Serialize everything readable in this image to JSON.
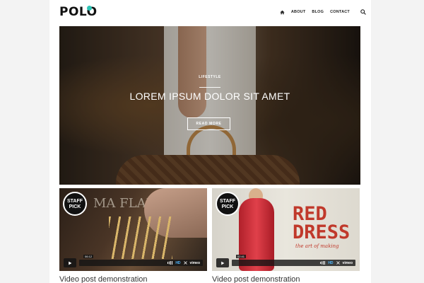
{
  "header": {
    "logo": "POLO",
    "nav": [
      {
        "id": "home",
        "icon": "home-icon"
      },
      {
        "id": "about",
        "label": "ABOUT"
      },
      {
        "id": "blog",
        "label": "BLOG"
      },
      {
        "id": "contact",
        "label": "CONTACT"
      }
    ],
    "search_icon": "search-icon",
    "accent": "#2ec4b6"
  },
  "hero": {
    "tag": "LIFESTYLE",
    "title": "LOREM IPSUM DOLOR SIT AMET",
    "button": "READ MORE"
  },
  "videos": [
    {
      "badge": "STAFF PICK",
      "overlay_text": "MA FLAMENCA",
      "time": "06:12",
      "hd": "HD",
      "brand": "vimeo",
      "caption": "Video post demonstration"
    },
    {
      "badge": "STAFF PICK",
      "overlay_title": "RED DRESS",
      "overlay_sub": "the art of making",
      "time": "02:41",
      "hd": "HD",
      "brand": "vimeo",
      "caption": "Video post demonstration"
    }
  ]
}
